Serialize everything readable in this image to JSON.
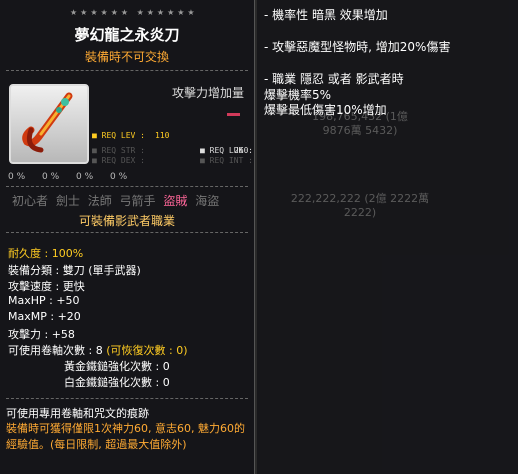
{
  "item": {
    "stars": "★★★★★★ ★★★★★★",
    "name": "夢幻龍之永炎刀",
    "trade": "裝備時不可交換",
    "attack_increase_label": "攻擊力增加量",
    "req": {
      "lev_label": "■ REQ LEV :",
      "lev_value": "110",
      "str_label": "■ REQ STR :",
      "dex_label": "■ REQ DEX :",
      "luk_label": "■ REQ LUK :",
      "luk_value": "260",
      "int_label": "■ REQ INT :"
    },
    "mini_icons": [
      "0 %",
      "0 %",
      "0 %",
      "0 %"
    ],
    "jobs": [
      "初心者",
      "劍士",
      "法師",
      "弓箭手",
      "盜賊",
      "海盜"
    ],
    "job_note": "可裝備影武者職業",
    "stats": {
      "durability": "耐久度 : 100%",
      "class": "裝備分類 : 雙刀 (單手武器)",
      "speed": "攻擊速度 : 更快",
      "hp": "MaxHP : +50",
      "mp": "MaxMP : +20",
      "atk": "攻擊力 : +58",
      "slots_label": "可使用卷軸次數 : 8",
      "slots_recover": "(可恢復次數 : 0)",
      "gold_hammer": "黃金鐵鎚強化次數 : 0",
      "silver_hammer": "白金鐵鎚強化次數 : 0"
    },
    "desc_line1": "可使用專用卷軸和咒文的痕跡",
    "desc_line2": "裝備時可獲得僅限1次神力60, 意志60, 魅力60的經驗值。(每日限制, 超過最大值除外)"
  },
  "potentials": {
    "line1": "- 機率性 暗黑 效果增加",
    "line2": "- 攻擊惡魔型怪物時, 增加20%傷害",
    "line3a": "- 職業 隱忍 或者 影武者時",
    "line3b": "爆擊機率5%",
    "line3c": "爆擊最低傷害10%增加"
  },
  "background": {
    "ghost_a": "198,765,432 (1億 9876萬 5432)",
    "ghost_b": "222,222,222 (2億 2222萬 2222)"
  },
  "colors": {
    "gold": "#ffcc22",
    "orange": "#ffaa33",
    "job_active": "#ff6699"
  }
}
